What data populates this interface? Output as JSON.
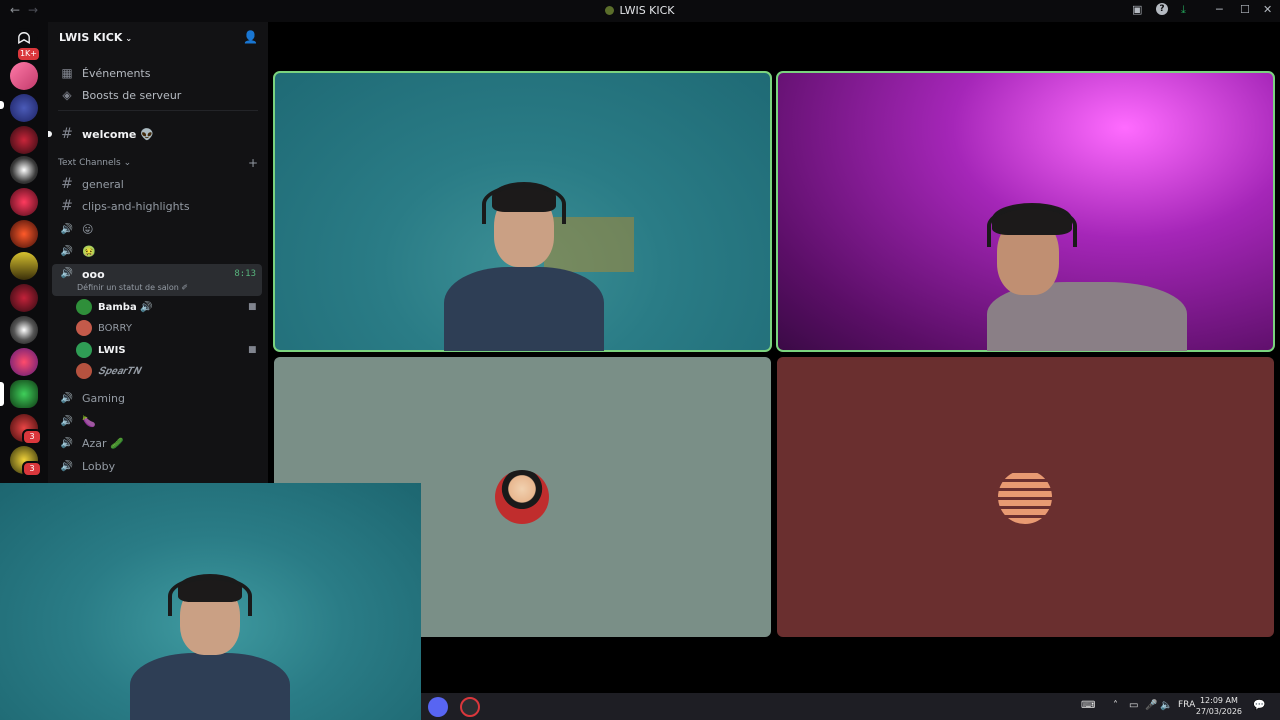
{
  "window": {
    "title": "LWIS KICK",
    "back_glyph": "←",
    "forward_glyph": "→",
    "minimize_glyph": "─",
    "maximize_glyph": "☐",
    "close_glyph": "✕",
    "inbox_glyph": "▣",
    "help_glyph": "?",
    "download_glyph": "⤓"
  },
  "server_rail": {
    "home_glyph": "ᗣ",
    "home_badge": "1K+",
    "badge_count_1": "3",
    "badge_count_2": "3"
  },
  "sidebar": {
    "server_name": "LWIS KICK",
    "server_caret": "⌄",
    "invite_glyph": "👤",
    "events_label": "Événements",
    "events_glyph": "▦",
    "boosts_label": "Boosts de serveur",
    "boosts_glyph": "◈",
    "welcome_label": "welcome 👽",
    "category_label": "Text Channels",
    "category_caret": "⌄",
    "category_plus": "+",
    "hash_glyph": "#",
    "voice_glyph": "🔊",
    "channels": {
      "general": "general",
      "clips": "clips-and-highlights",
      "emoji_1": "😛",
      "emoji_2": "🤢",
      "ooo": "ooo",
      "ooo_timer": "8:13",
      "ooo_status": "Définir un statut de salon ✐",
      "gaming": "Gaming",
      "eggplant": "🍆",
      "azar": "Azar 🥒",
      "lobby": "Lobby"
    },
    "voice_users": [
      {
        "name": "Bamba 🔊",
        "avatar_color": "#2f8f3a",
        "has_cam": true,
        "bold": true
      },
      {
        "name": "BORRY",
        "avatar_color": "#c45a4a",
        "has_cam": false,
        "bold": false
      },
      {
        "name": "LWIS",
        "avatar_color": "#2f9d55",
        "has_cam": true,
        "bold": true
      },
      {
        "name": "𝑺𝒑𝒆𝒂𝒓𝑻𝑵",
        "avatar_color": "#b5523f",
        "has_cam": false,
        "bold": false
      }
    ],
    "cam_glyph": "■"
  },
  "video_grid": {
    "tile_3_bg": "#7a8f87",
    "tile_4_bg": "#6a2f2f"
  },
  "taskbar": {
    "lang": "FRA",
    "time": "12:09 AM",
    "date": "27/03/2026",
    "up_glyph": "˄",
    "net_glyph": "▭",
    "mic_glyph": "🎤",
    "vol_glyph": "🔈",
    "notif_glyph": "💬",
    "kbd_glyph": "⌨"
  },
  "colors": {
    "speaking_outline": "#7bd37f",
    "accent_red": "#da373c"
  }
}
